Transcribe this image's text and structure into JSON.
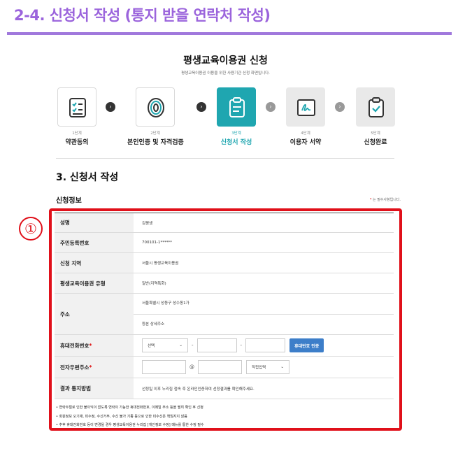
{
  "slide_title": "2-4. 신청서 작성 (통지 받을 연락처 작성)",
  "page_title": "평생교육이용권 신청",
  "page_subtitle": "평생교육이용권 이용을 위한 사용기관 신청 화면입니다.",
  "steps": [
    {
      "num": "1단계",
      "label": "약관동의",
      "icon": "checklist-icon"
    },
    {
      "num": "2단계",
      "label": "본인인증 및 자격검증",
      "icon": "fingerprint-icon"
    },
    {
      "num": "3단계",
      "label": "신청서 작성",
      "icon": "clipboard-form-icon",
      "active": true
    },
    {
      "num": "4단계",
      "label": "이용자 서약",
      "icon": "signature-icon"
    },
    {
      "num": "5단계",
      "label": "신청완료",
      "icon": "clipboard-check-icon"
    }
  ],
  "section_title": "3. 신청서 작성",
  "info_title": "신청정보",
  "required_note": {
    "star": "*",
    "text": "는 필수사항입니다."
  },
  "callout_number": "①",
  "form": {
    "name_label": "성명",
    "name_value": "김평생",
    "rrn_label": "주민등록번호",
    "rrn_value": "700101-1******",
    "region_label": "신청 지역",
    "region_value": "서울시 평생교육이용권",
    "type_label": "평생교육이용권 유형",
    "type_value": "일반(지역특화)",
    "address_label": "주소",
    "address_line1": "서울특별시 성동구 성수동1가",
    "address_line2": "등본 상세주소",
    "phone_label": "휴대전화번호",
    "phone_select": "선택",
    "phone_sep": "-",
    "phone_verify_button": "휴대번호 인증",
    "email_label": "전자우편주소",
    "email_at": "@",
    "email_domain_select": "직접입력",
    "notify_label": "결과 통지방법",
    "notify_value": "선정일 이후 누리집 접속 후 온라인인증하여 선정결과를 확인해주세요.",
    "required_star": "*"
  },
  "notes": [
    "• 연락두절로 인한 불이익이 없도록 연락이 가능한 휴대전화번호, 이메일 주소 등을 필히 확인 후 신청",
    "• 회원정보 오기재, 미수정, 수신거부, 수신 불가 기종 등으로 인한 미수신은 책임지지 않음",
    "• 추후 휴대전화번호 등이 변경될 경우 평생교육이용권 누리집 [개인정보 수정] 메뉴를 통한 수정 필수"
  ],
  "colors": {
    "accent_purple": "#9b64dc",
    "active_teal": "#1fa6b0",
    "highlight_red": "#e0101a",
    "button_blue": "#3d7ec9"
  }
}
